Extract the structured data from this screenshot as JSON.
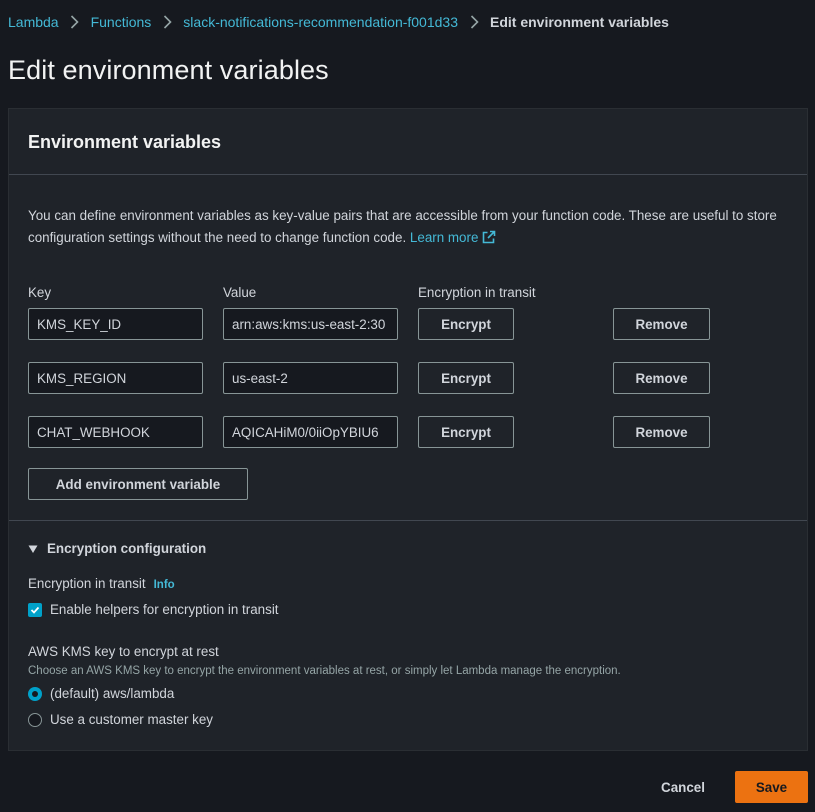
{
  "breadcrumb": {
    "items": [
      "Lambda",
      "Functions",
      "slack-notifications-recommendation-f001d33"
    ],
    "current": "Edit environment variables"
  },
  "page_title": "Edit environment variables",
  "env_section": {
    "title": "Environment variables",
    "description": "You can define environment variables as key-value pairs that are accessible from your function code. These are useful to store configuration settings without the need to change function code.",
    "learn_more": "Learn more",
    "columns": {
      "key": "Key",
      "value": "Value",
      "encryption": "Encryption in transit"
    },
    "variables": [
      {
        "key": "KMS_KEY_ID",
        "value": "arn:aws:kms:us-east-2:30"
      },
      {
        "key": "KMS_REGION",
        "value": "us-east-2"
      },
      {
        "key": "CHAT_WEBHOOK",
        "value": "AQICAHiM0/0iiOpYBIU6"
      }
    ],
    "encrypt_label": "Encrypt",
    "remove_label": "Remove",
    "add_label": "Add environment variable"
  },
  "encryption_config": {
    "title": "Encryption configuration",
    "transit_label": "Encryption in transit",
    "info_label": "Info",
    "helpers_label": "Enable helpers for encryption in transit",
    "helpers_checked": true,
    "kms_label": "AWS KMS key to encrypt at rest",
    "kms_description": "Choose an AWS KMS key to encrypt the environment variables at rest, or simply let Lambda manage the encryption.",
    "options": [
      "(default) aws/lambda",
      "Use a customer master key"
    ],
    "selected_option": 0
  },
  "footer": {
    "cancel_label": "Cancel",
    "save_label": "Save"
  },
  "colors": {
    "accent": "#44b9d6",
    "primary": "#ec7211",
    "background": "#16191f",
    "panel": "#1f2329"
  }
}
